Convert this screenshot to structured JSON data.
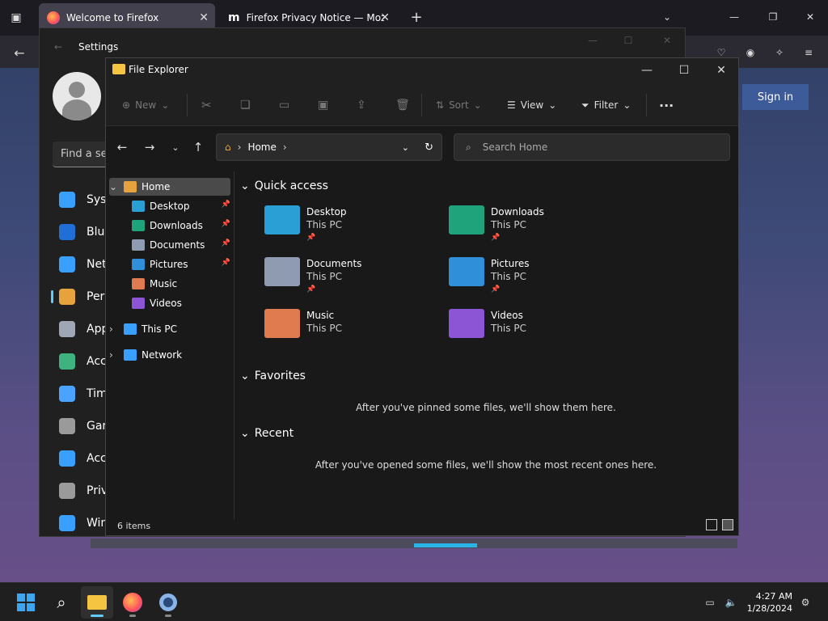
{
  "firefox": {
    "tabs": [
      {
        "label": "Welcome to Firefox",
        "active": true
      },
      {
        "label": "Firefox Privacy Notice — Mozill",
        "active": false
      }
    ],
    "sign_in": "Sign in"
  },
  "settings": {
    "title": "Settings",
    "find_placeholder": "Find a se",
    "nav": [
      {
        "label": "Syst",
        "icon": "monitor-icon",
        "color": "#3aa0ff"
      },
      {
        "label": "Blue",
        "icon": "bluetooth-icon",
        "color": "#1f6fd6"
      },
      {
        "label": "Net",
        "icon": "wifi-icon",
        "color": "#3aa0ff"
      },
      {
        "label": "Pers",
        "icon": "brush-icon",
        "color": "#e6a23c",
        "selected": true
      },
      {
        "label": "App",
        "icon": "apps-icon",
        "color": "#9ea7b3"
      },
      {
        "label": "Acc",
        "icon": "person-icon",
        "color": "#3fb37f"
      },
      {
        "label": "Tim",
        "icon": "clock-globe-icon",
        "color": "#4aa3ff"
      },
      {
        "label": "Gar",
        "icon": "gamepad-icon",
        "color": "#9a9a9a"
      },
      {
        "label": "Acc",
        "icon": "accessibility-icon",
        "color": "#3aa0ff"
      },
      {
        "label": "Priv",
        "icon": "shield-icon",
        "color": "#9a9a9a"
      },
      {
        "label": "Win",
        "icon": "update-icon",
        "color": "#3aa0ff"
      }
    ]
  },
  "explorer": {
    "title": "File Explorer",
    "commands": {
      "new": "New",
      "sort": "Sort",
      "view": "View",
      "filter": "Filter"
    },
    "address": {
      "crumb": "Home"
    },
    "search_placeholder": "Search Home",
    "tree": [
      {
        "label": "Home",
        "icon": "home-icon",
        "selected": true,
        "level": 0,
        "expander": "expanded"
      },
      {
        "label": "Desktop",
        "icon": "desktop-icon",
        "level": 1,
        "pinned": true
      },
      {
        "label": "Downloads",
        "icon": "download-icon",
        "level": 1,
        "pinned": true
      },
      {
        "label": "Documents",
        "icon": "documents-icon",
        "level": 1,
        "pinned": true
      },
      {
        "label": "Pictures",
        "icon": "pictures-icon",
        "level": 1,
        "pinned": true
      },
      {
        "label": "Music",
        "icon": "music-icon",
        "level": 1
      },
      {
        "label": "Videos",
        "icon": "videos-icon",
        "level": 1
      },
      {
        "label": "This PC",
        "icon": "computer-icon",
        "level": 0,
        "expander": "collapsed"
      },
      {
        "label": "Network",
        "icon": "network-icon",
        "level": 0,
        "expander": "collapsed"
      }
    ],
    "sections": {
      "quick_access": "Quick access",
      "favorites": "Favorites",
      "recent": "Recent"
    },
    "quick_access": [
      {
        "name": "Desktop",
        "location": "This PC",
        "pinned": true,
        "color": "#2a9fd6"
      },
      {
        "name": "Downloads",
        "location": "This PC",
        "pinned": true,
        "color": "#1fa37a"
      },
      {
        "name": "Documents",
        "location": "This PC",
        "pinned": true,
        "color": "#8e9bb0"
      },
      {
        "name": "Pictures",
        "location": "This PC",
        "pinned": true,
        "color": "#2f8fd8"
      },
      {
        "name": "Music",
        "location": "This PC",
        "pinned": false,
        "color": "#e07b4f"
      },
      {
        "name": "Videos",
        "location": "This PC",
        "pinned": false,
        "color": "#8b55d6"
      }
    ],
    "favorites_empty": "After you've pinned some files, we'll show them here.",
    "recent_empty": "After you've opened some files, we'll show the most recent ones here.",
    "status": "6 items"
  },
  "taskbar": {
    "apps": [
      {
        "name": "start",
        "icon": "windows-logo-icon"
      },
      {
        "name": "search",
        "icon": "search-icon"
      },
      {
        "name": "file-explorer",
        "icon": "folder-icon",
        "active": true
      },
      {
        "name": "firefox",
        "icon": "firefox-icon"
      },
      {
        "name": "settings",
        "icon": "gear-icon"
      }
    ],
    "time": "4:27 AM",
    "date": "1/28/2024"
  },
  "colors": {
    "accent": "#60cdff",
    "explorer_bg": "#191919",
    "taskbar_bg": "#1f1f1f"
  }
}
